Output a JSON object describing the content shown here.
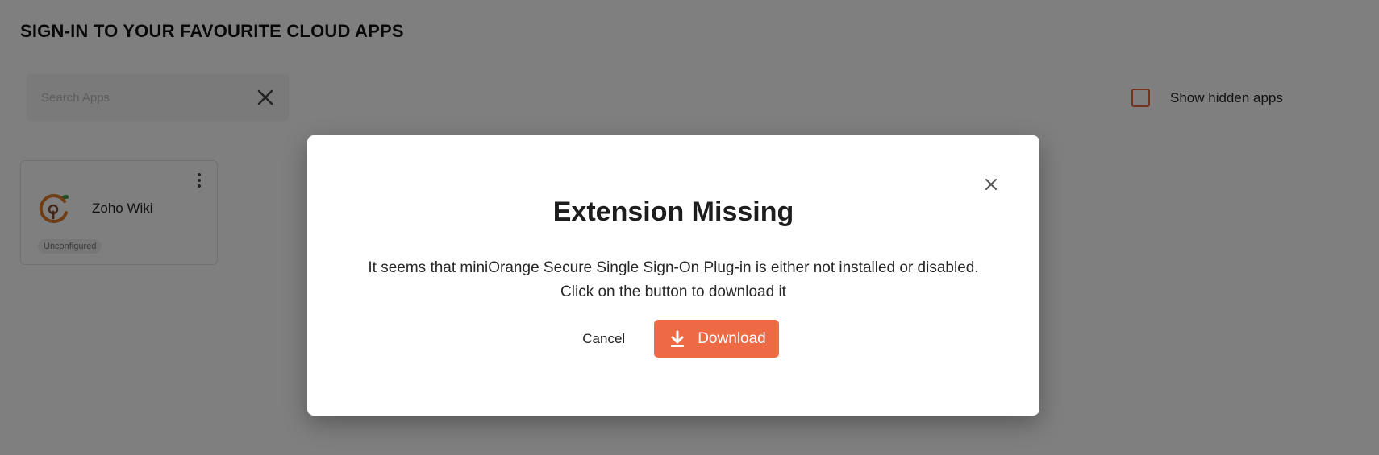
{
  "page": {
    "title": "SIGN-IN TO YOUR FAVOURITE CLOUD APPS",
    "search": {
      "value": "",
      "placeholder": "Search Apps"
    },
    "show_hidden_label": "Show hidden apps"
  },
  "apps": [
    {
      "name": "Zoho Wiki",
      "status": "Unconfigured",
      "icon": "zoho-wiki-logo-icon"
    }
  ],
  "modal": {
    "title": "Extension Missing",
    "message_line1": "It seems that miniOrange Secure Single Sign-On Plug-in is either not installed or disabled.",
    "message_line2": "Click on the button to download it",
    "cancel_label": "Cancel",
    "download_label": "Download"
  },
  "colors": {
    "accent": "#ee6a44",
    "checkbox_border": "#e8663d",
    "overlay": "rgba(0,0,0,0.5)"
  },
  "icons": [
    "close-icon",
    "kebab-menu-icon",
    "download-icon",
    "zoho-wiki-logo-icon"
  ]
}
